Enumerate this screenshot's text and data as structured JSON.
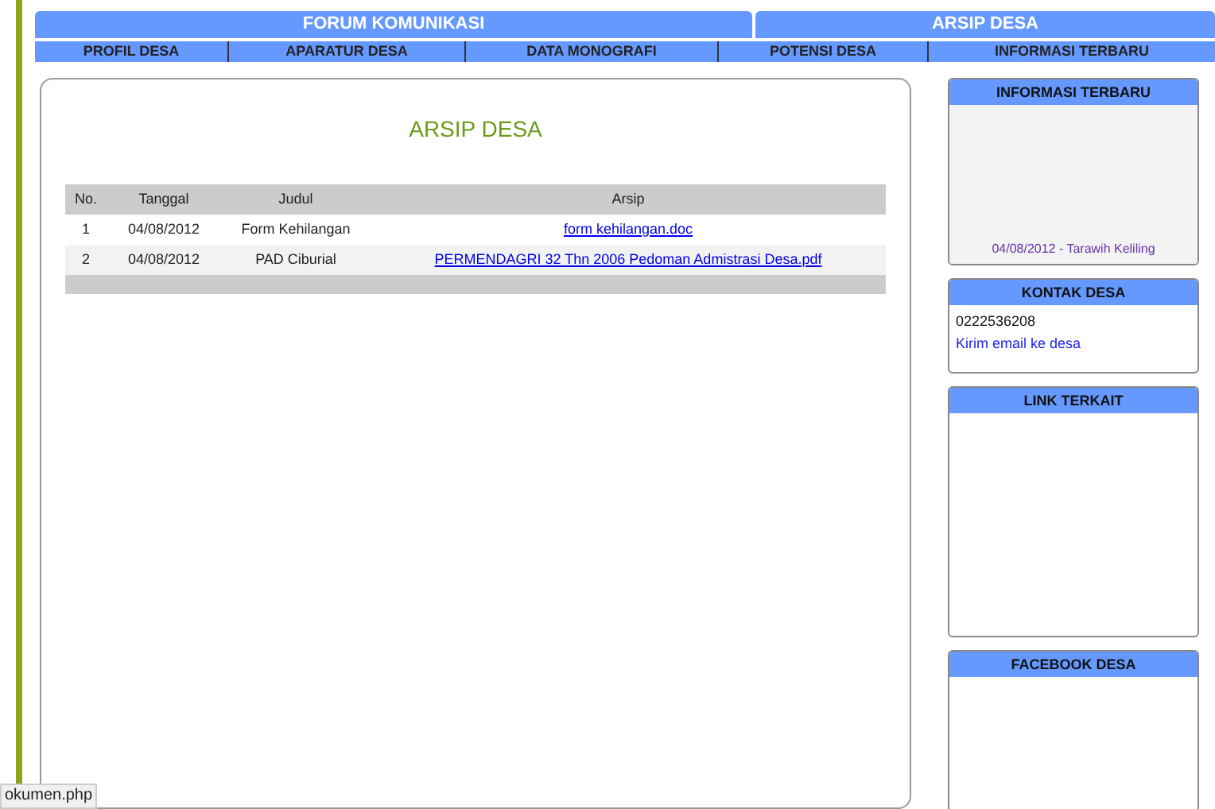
{
  "header": {
    "tabs": [
      "FORUM KOMUNIKASI",
      "ARSIP DESA"
    ]
  },
  "nav": [
    "PROFIL DESA",
    "APARATUR DESA",
    "DATA MONOGRAFI",
    "POTENSI DESA",
    "INFORMASI TERBARU"
  ],
  "main": {
    "title": "ARSIP DESA",
    "table": {
      "columns": [
        "No.",
        "Tanggal",
        "Judul",
        "Arsip"
      ],
      "rows": [
        {
          "no": "1",
          "date": "04/08/2012",
          "title": "Form Kehilangan",
          "file": "form kehilangan.doc"
        },
        {
          "no": "2",
          "date": "04/08/2012",
          "title": "PAD Ciburial",
          "file": "PERMENDAGRI 32 Thn 2006 Pedoman Admistrasi Desa.pdf"
        }
      ]
    }
  },
  "sidebar": [
    {
      "kind": "ticker",
      "title": "INFORMASI TERBARU",
      "items": [
        "04/08/2012 - Tarawih Keliling"
      ]
    },
    {
      "kind": "contact",
      "title": "KONTAK DESA",
      "phone": "0222536208",
      "link": "Kirim email ke desa"
    },
    {
      "kind": "empty",
      "title": "LINK TERKAIT"
    },
    {
      "kind": "empty",
      "title": "FACEBOOK DESA"
    }
  ],
  "status_bar": "okumen.php"
}
